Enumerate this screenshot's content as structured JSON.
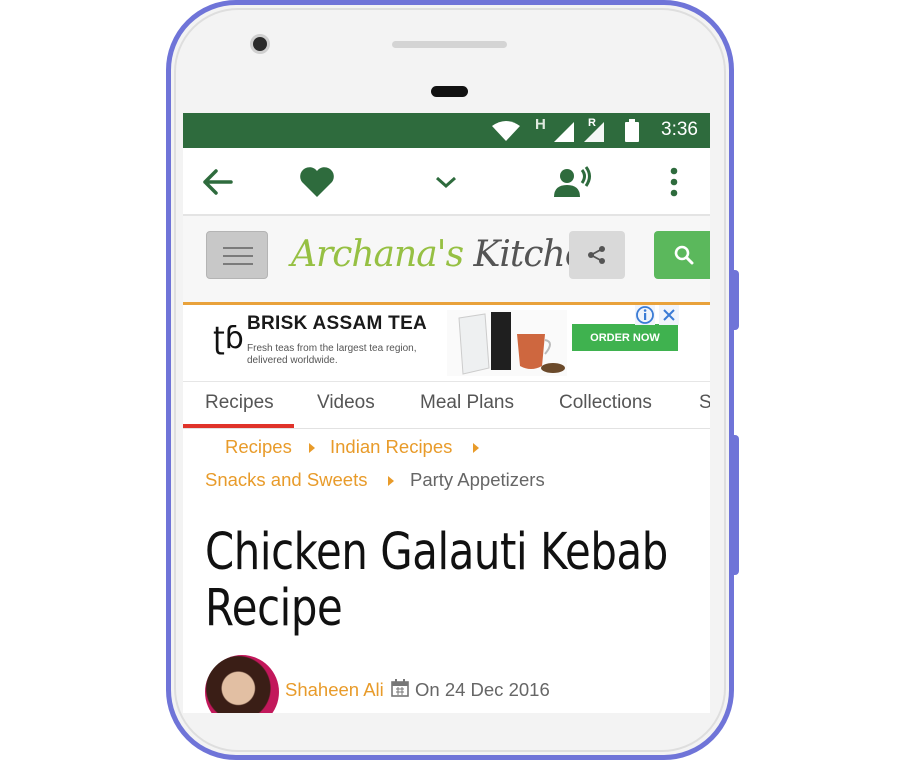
{
  "status_bar": {
    "time": "3:36",
    "network_label": "H",
    "roaming_label": "R",
    "icons": [
      "wifi-icon",
      "signal-icon",
      "signal-roaming-icon",
      "battery-icon"
    ]
  },
  "app_bar": {
    "icons": [
      "back-arrow-icon",
      "heart-icon",
      "chevron-down-icon",
      "voice-icon",
      "more-vert-icon"
    ]
  },
  "site_header": {
    "logo_text_1": "Archana's",
    "logo_text_2": "Kitchen",
    "brand_color": "#96c043",
    "icons": [
      "hamburger-icon",
      "share-icon",
      "search-icon"
    ]
  },
  "ad": {
    "logo_text": "ʈɓ",
    "title": "BRISK ASSAM TEA",
    "description": "Fresh teas from the largest tea region, delivered worldwide.",
    "cta": "ORDER NOW",
    "cta_color": "#3fb24f",
    "icons": [
      "ad-info-icon",
      "ad-close-icon"
    ]
  },
  "nav_tabs": [
    {
      "label": "Recipes",
      "active": true
    },
    {
      "label": "Videos"
    },
    {
      "label": "Meal Plans"
    },
    {
      "label": "Collections"
    },
    {
      "label": "S"
    }
  ],
  "breadcrumbs": [
    {
      "label": "Recipes"
    },
    {
      "label": "Indian Recipes"
    },
    {
      "label": "Snacks and Sweets"
    },
    {
      "label": "Party Appetizers"
    }
  ],
  "article": {
    "title": "Chicken Galauti Kebab Recipe",
    "author": "Shaheen Ali",
    "date": "On 24 Dec 2016"
  },
  "colors": {
    "status_bar": "#2e6b3d",
    "accent_orange": "#e89b2a",
    "tab_active_underline": "#e0332a",
    "phone_frame": "#6f74d8"
  }
}
